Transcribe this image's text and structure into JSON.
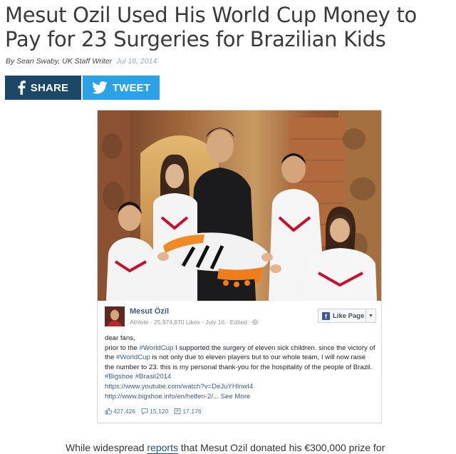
{
  "article": {
    "title": "Mesut Ozil Used His World Cup Money to Pay for 23 Surgeries for Brazilian Kids",
    "byline": "By Sean Swaby, UK Staff Writer",
    "date": "Jul 16, 2014"
  },
  "share": {
    "facebook_label": "SHARE",
    "twitter_label": "TWEET",
    "facebook_color": "#1d4766",
    "twitter_color": "#2ba1e6"
  },
  "fb_post": {
    "author": "Mesut Özil",
    "meta": "Athlete · 25,974,870 Likes · July 16 · Edited ·",
    "like_button": "Like Page",
    "greeting": "dear fans,",
    "text_1": "prior to the ",
    "hashtag_1": "#WorldCup",
    "text_2": " I supported the surgery of eleven sick children. since the victory of the ",
    "hashtag_2": "#WorldCup",
    "text_3": " is not only due to eleven players but to our whole team, I will now raise the number to 23. this is my personal thank-you for the hospitality of the people of Brazil. ",
    "hashtag_3": "#Bigshoe",
    "hashtag_4": "#Brasil2014",
    "link_1": "https://www.youtube.com/watch?v=DeJuYHlnwI4",
    "link_2": "http://www.bigshoe.info/en/helfen-2/...",
    "see_more": "See More",
    "likes": "427,426",
    "comments": "15,120",
    "shares": "17,176"
  },
  "body": {
    "text_1": "While widespread ",
    "link": "reports",
    "text_2": " that Mesut Ozil donated his €300,000 prize for"
  }
}
